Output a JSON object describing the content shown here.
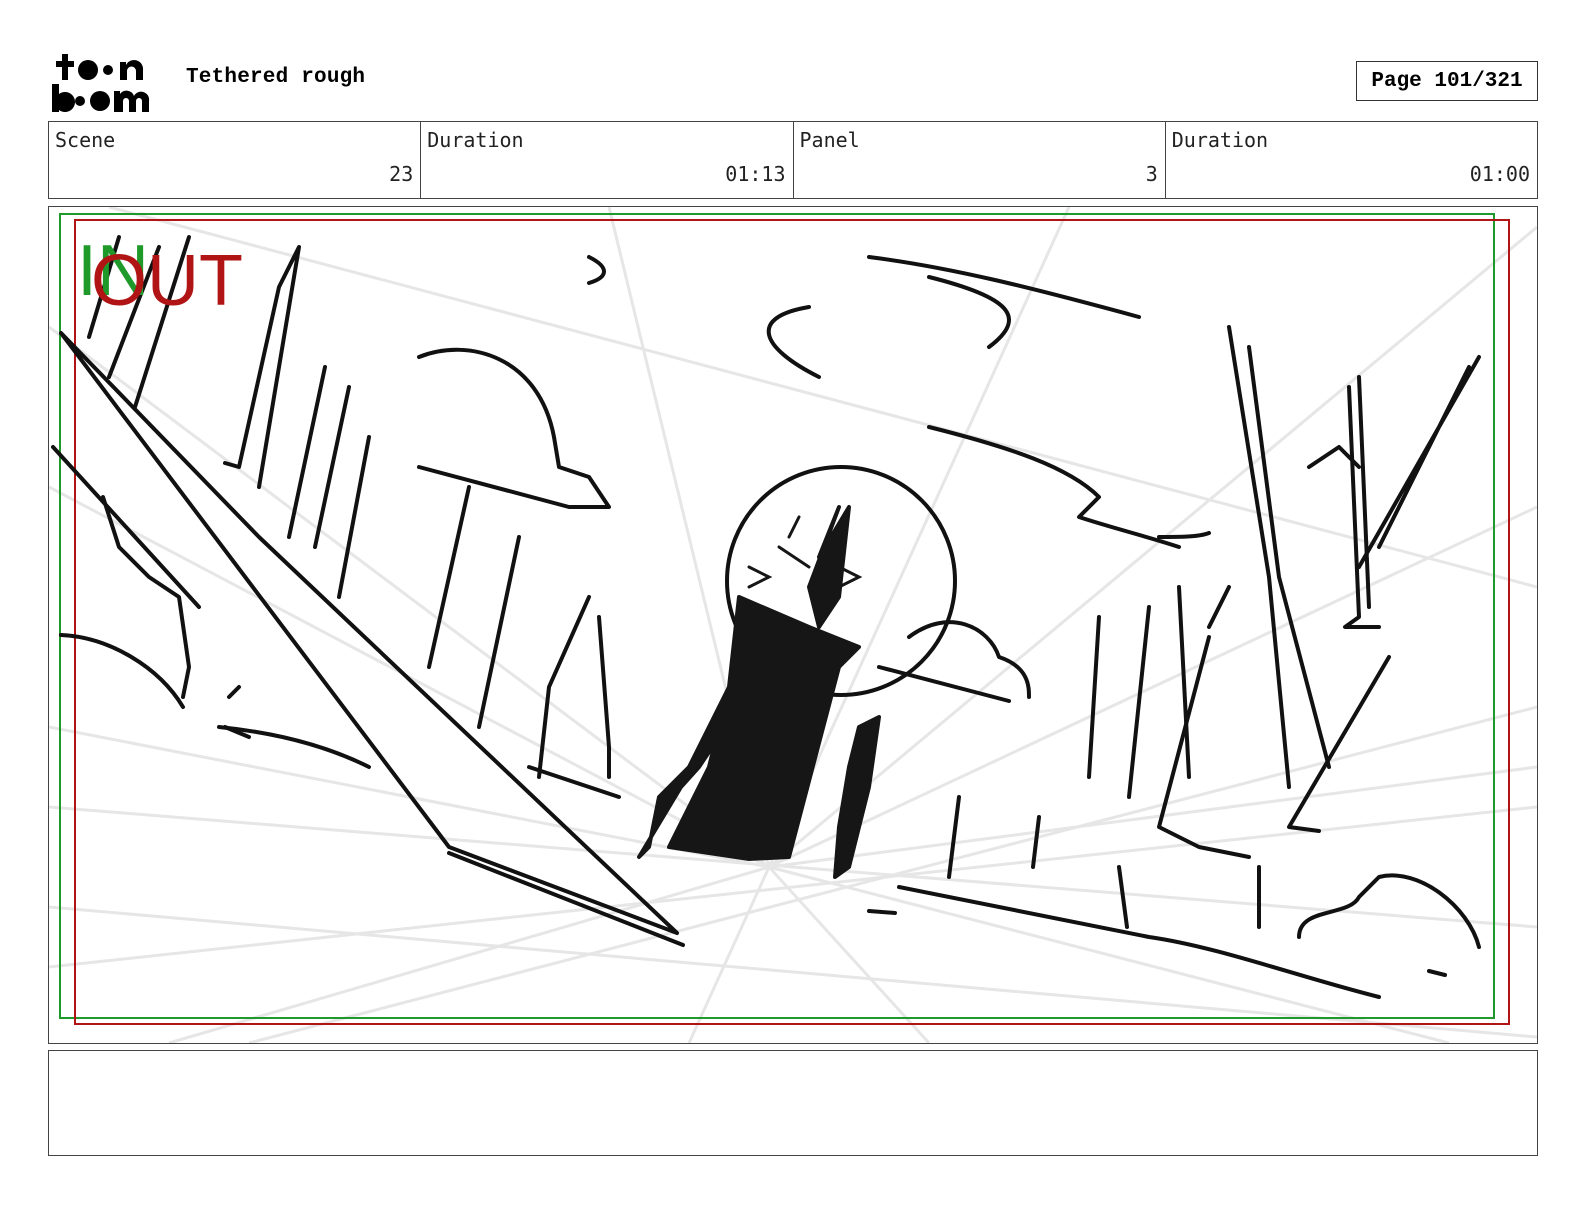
{
  "header": {
    "title": "Tethered rough",
    "page_label": "Page 101/321"
  },
  "logo": {
    "text": "toon boom",
    "icon": "toon-boom-logo"
  },
  "info": {
    "scene_label": "Scene",
    "scene_value": "23",
    "scene_duration_label": "Duration",
    "scene_duration_value": "01:13",
    "panel_label": "Panel",
    "panel_value": "3",
    "panel_duration_label": "Duration",
    "panel_duration_value": "01:00"
  },
  "panel_markers": {
    "in": "IN",
    "out": "OUT"
  },
  "colors": {
    "safe_in": "#1f9a2a",
    "safe_out": "#b11414",
    "guide": "#e6e6e6"
  }
}
